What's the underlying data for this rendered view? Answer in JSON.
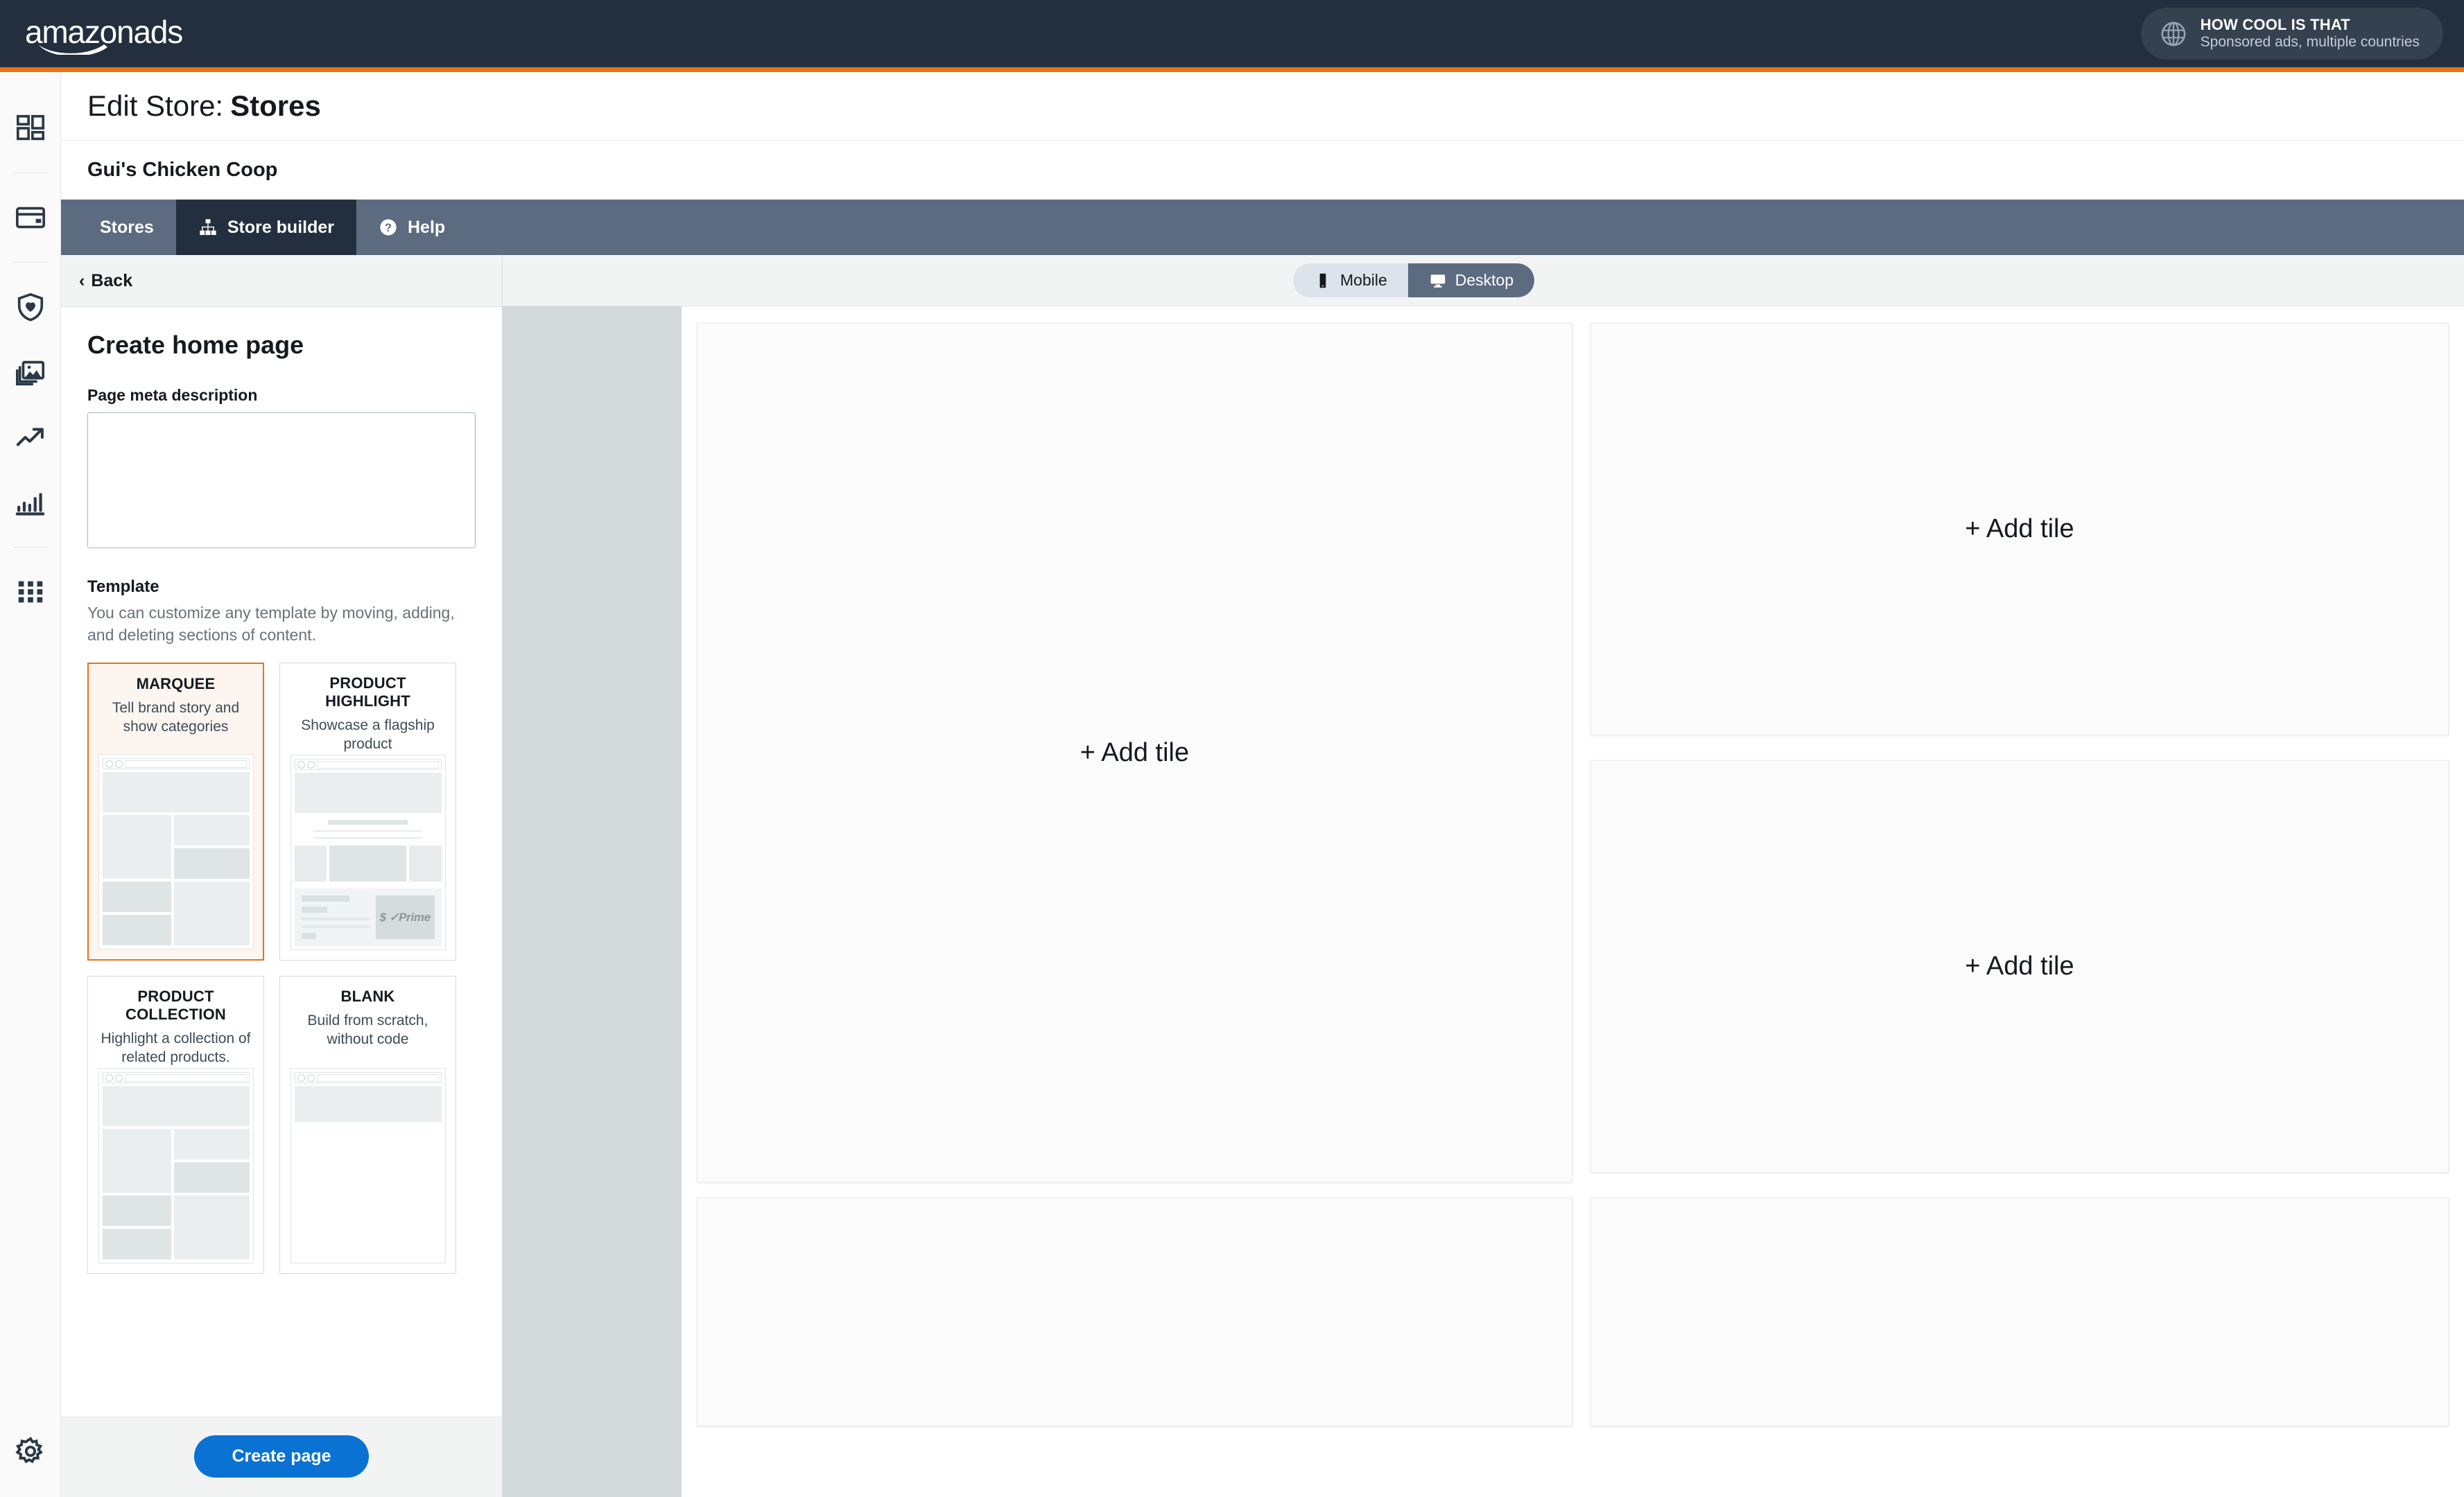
{
  "topbar": {
    "logo_text": "amazonads",
    "logo_icon": "amazon-smile-icon",
    "account": {
      "icon": "globe-icon",
      "name": "HOW COOL IS THAT",
      "subtitle": "Sponsored ads, multiple countries"
    }
  },
  "rail": {
    "items": [
      {
        "icon": "dashboard-grid-icon",
        "name": "dashboard"
      },
      {
        "icon": "credit-card-icon",
        "name": "billing"
      },
      {
        "icon": "shield-heart-icon",
        "name": "brand-protection"
      },
      {
        "icon": "image-stack-icon",
        "name": "creative-assets"
      },
      {
        "icon": "trending-up-icon",
        "name": "campaigns"
      },
      {
        "icon": "bar-chart-icon",
        "name": "reports"
      },
      {
        "icon": "app-grid-icon",
        "name": "all-apps"
      }
    ],
    "bottom": {
      "icon": "gear-icon",
      "name": "settings"
    }
  },
  "page": {
    "header_prefix": "Edit Store:",
    "header_value": "Stores",
    "store_name": "Gui's Chicken Coop"
  },
  "nav": {
    "tabs": [
      {
        "label": "Stores",
        "icon": "",
        "active": false
      },
      {
        "label": "Store builder",
        "icon": "sitemap-icon",
        "active": true
      },
      {
        "label": "Help",
        "icon": "question-circle-icon",
        "active": false
      }
    ]
  },
  "sidebar": {
    "back_label": "Back",
    "back_icon": "chevron-left-icon",
    "title": "Create home page",
    "meta": {
      "label": "Page meta description",
      "value": "",
      "placeholder": ""
    },
    "template": {
      "title": "Template",
      "description": "You can customize any template by moving, adding, and deleting sections of content.",
      "options": [
        {
          "name": "MARQUEE",
          "description": "Tell brand story and show categories",
          "selected": true,
          "thumb": "grid-layout"
        },
        {
          "name": "PRODUCT HIGHLIGHT",
          "description": "Showcase a flagship product",
          "selected": false,
          "thumb": "product-highlight",
          "badge": "$ ✓Prime"
        },
        {
          "name": "PRODUCT COLLECTION",
          "description": "Highlight a collection of related products.",
          "selected": false,
          "thumb": "grid-layout"
        },
        {
          "name": "BLANK",
          "description": "Build from scratch, without code",
          "selected": false,
          "thumb": "blank-layout"
        }
      ]
    },
    "create_button": "Create page"
  },
  "preview": {
    "device_toggle": {
      "mobile": {
        "label": "Mobile",
        "icon": "mobile-icon",
        "active": false
      },
      "desktop": {
        "label": "Desktop",
        "icon": "desktop-icon",
        "active": true
      }
    },
    "tiles": [
      {
        "label": "+ Add tile"
      },
      {
        "label": "+ Add tile"
      },
      {
        "label": "+ Add tile"
      },
      {
        "label": ""
      },
      {
        "label": ""
      }
    ]
  },
  "colors": {
    "brand_dark": "#232f3e",
    "brand_orange": "#ec7211",
    "nav_slate": "#5c6b80",
    "accent_blue": "#0972d3",
    "gutter_gray": "#d4dadb"
  }
}
